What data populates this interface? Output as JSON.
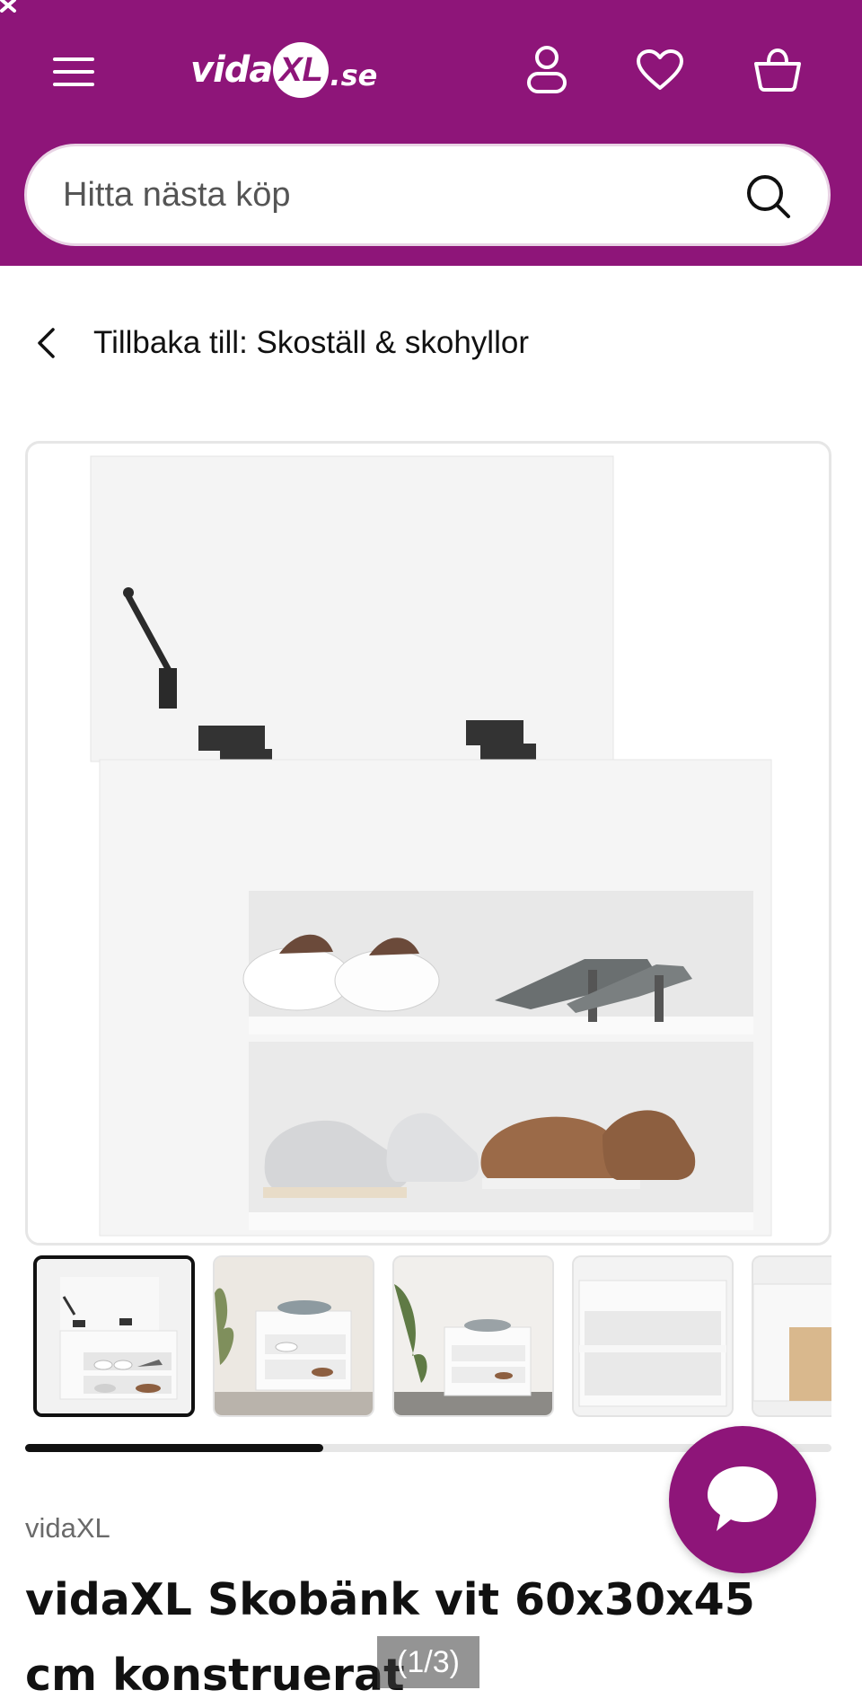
{
  "header": {
    "logo": "vidaXL.se",
    "logo_parts": {
      "left": "vida",
      "mark": "XL",
      "right": ".se"
    },
    "background_color": "#8e1579",
    "icons": [
      "menu-icon",
      "user-icon",
      "heart-icon",
      "basket-icon",
      "close-icon"
    ]
  },
  "search": {
    "placeholder": "Hitta nästa köp",
    "value": ""
  },
  "breadcrumb": {
    "back_label": "Tillbaka till: Skoställ & skohyllor"
  },
  "gallery": {
    "thumbnail_count": 5,
    "active_thumbnail": 1,
    "scroll_progress": 0.37,
    "counter": "(1/3)"
  },
  "product": {
    "brand": "vidaXL",
    "title_line1": "vidaXL Skobänk vit 60x30x45",
    "title_line2": "cm konstruerat"
  },
  "chat": {
    "icon": "chat-bubble-icon",
    "color": "#8e1579"
  }
}
